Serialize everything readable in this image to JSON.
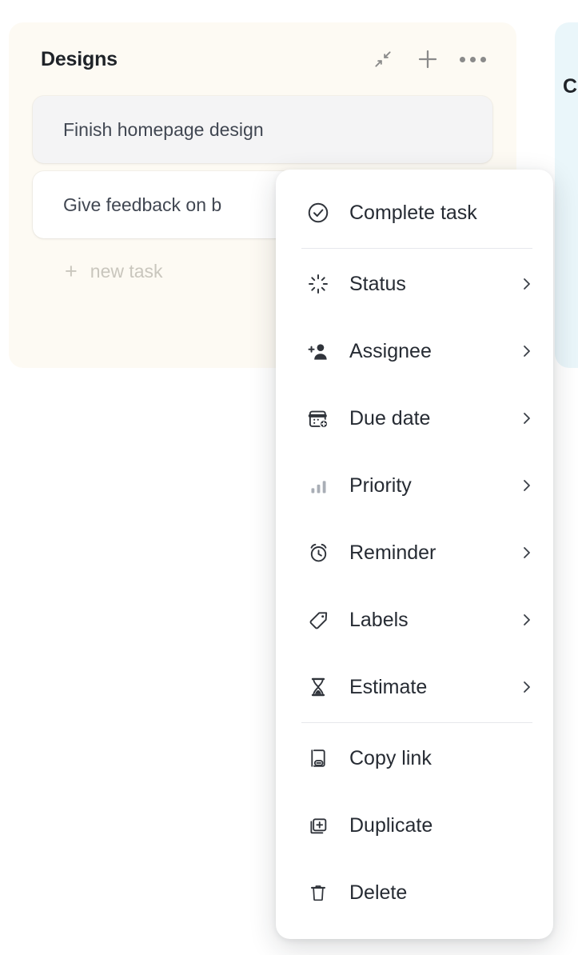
{
  "board": {
    "column": {
      "title": "Designs",
      "actions": [
        {
          "name": "collapse",
          "icon": "collapse-icon"
        },
        {
          "name": "add",
          "icon": "plus-icon"
        },
        {
          "name": "more",
          "icon": "ellipsis-icon"
        }
      ],
      "tasks": [
        {
          "title": "Finish homepage design",
          "state": "hovered"
        },
        {
          "title": "Give feedback on b",
          "state": "plain"
        }
      ],
      "new_task_label": "new task",
      "new_task_glyph": "+"
    },
    "next_column": {
      "partial_letter": "C",
      "color": "#eaf6fa"
    }
  },
  "context_menu": {
    "groups": [
      {
        "items": [
          {
            "label": "Complete task",
            "icon": "check-circle-icon",
            "has_submenu": false
          }
        ]
      },
      {
        "items": [
          {
            "label": "Status",
            "icon": "status-spinner-icon",
            "has_submenu": true
          },
          {
            "label": "Assignee",
            "icon": "person-plus-icon",
            "has_submenu": true
          },
          {
            "label": "Due date",
            "icon": "calendar-plus-icon",
            "has_submenu": true
          },
          {
            "label": "Priority",
            "icon": "bar-chart-icon",
            "has_submenu": true
          },
          {
            "label": "Reminder",
            "icon": "alarm-clock-icon",
            "has_submenu": true
          },
          {
            "label": "Labels",
            "icon": "tag-icon",
            "has_submenu": true
          },
          {
            "label": "Estimate",
            "icon": "hourglass-icon",
            "has_submenu": true
          }
        ]
      },
      {
        "items": [
          {
            "label": "Copy link",
            "icon": "copy-link-icon",
            "has_submenu": false
          },
          {
            "label": "Duplicate",
            "icon": "duplicate-icon",
            "has_submenu": false
          },
          {
            "label": "Delete",
            "icon": "trash-icon",
            "has_submenu": false
          }
        ]
      }
    ]
  },
  "colors": {
    "column_bg": "#fdfaf3",
    "card_hover": "#f4f4f5",
    "card_plain": "#ffffff",
    "menu_bg": "#ffffff",
    "text": "#262b33",
    "muted": "#c9c6bd"
  }
}
